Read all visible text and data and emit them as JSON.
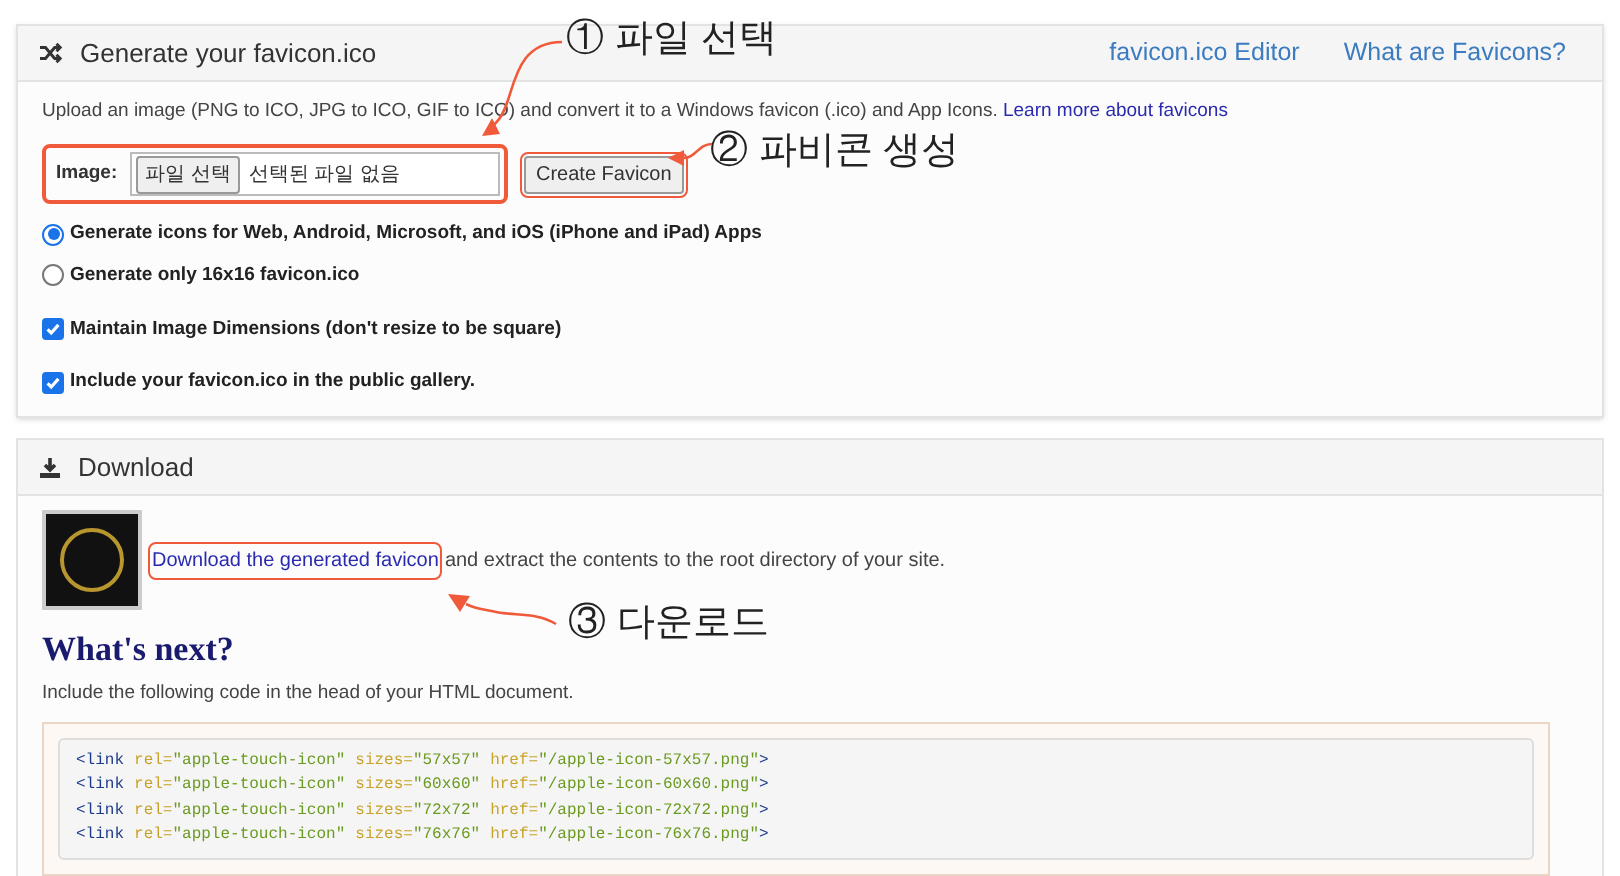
{
  "generator_panel": {
    "title": "Generate your favicon.ico",
    "header_links": [
      "favicon.ico Editor",
      "What are Favicons?"
    ],
    "intro": {
      "text": "Upload an image (PNG to ICO, JPG to ICO, GIF to ICO) and convert it to a Windows favicon (.ico) and App Icons.",
      "link": "Learn more about favicons"
    },
    "image_label": "Image:",
    "file_button": "파일 선택",
    "file_status": "선택된 파일 없음",
    "create_button": "Create Favicon",
    "radios": [
      {
        "label": "Generate icons for Web, Android, Microsoft, and iOS (iPhone and iPad) Apps",
        "selected": true
      },
      {
        "label": "Generate only 16x16 favicon.ico",
        "selected": false
      }
    ],
    "checkboxes": [
      {
        "label": "Maintain Image Dimensions (don't resize to be square)",
        "checked": true
      },
      {
        "label": "Include your favicon.ico in the public gallery.",
        "checked": true
      }
    ]
  },
  "download_panel": {
    "title": "Download",
    "link": "Download the generated favicon",
    "text": "and extract the contents to the root directory of your site.",
    "heading": "What's next?",
    "instruction": "Include the following code in the head of your HTML document.",
    "code_lines": [
      [
        {
          "kind": "tag",
          "text": "<link"
        },
        {
          "kind": "attr",
          "text": "rel="
        },
        {
          "kind": "value",
          "text": "\"apple-touch-icon\""
        },
        {
          "kind": "attr",
          "text": "sizes="
        },
        {
          "kind": "value",
          "text": "\"57x57\""
        },
        {
          "kind": "attr",
          "text": "href="
        },
        {
          "kind": "value",
          "text": "\"/apple-icon-57x57.png\""
        },
        {
          "kind": "tag",
          "text": ">"
        }
      ],
      [
        {
          "kind": "tag",
          "text": "<link"
        },
        {
          "kind": "attr",
          "text": "rel="
        },
        {
          "kind": "value",
          "text": "\"apple-touch-icon\""
        },
        {
          "kind": "attr",
          "text": "sizes="
        },
        {
          "kind": "value",
          "text": "\"60x60\""
        },
        {
          "kind": "attr",
          "text": "href="
        },
        {
          "kind": "value",
          "text": "\"/apple-icon-60x60.png\""
        },
        {
          "kind": "tag",
          "text": ">"
        }
      ],
      [
        {
          "kind": "tag",
          "text": "<link"
        },
        {
          "kind": "attr",
          "text": "rel="
        },
        {
          "kind": "value",
          "text": "\"apple-touch-icon\""
        },
        {
          "kind": "attr",
          "text": "sizes="
        },
        {
          "kind": "value",
          "text": "\"72x72\""
        },
        {
          "kind": "attr",
          "text": "href="
        },
        {
          "kind": "value",
          "text": "\"/apple-icon-72x72.png\""
        },
        {
          "kind": "tag",
          "text": ">"
        }
      ],
      [
        {
          "kind": "tag",
          "text": "<link"
        },
        {
          "kind": "attr",
          "text": "rel="
        },
        {
          "kind": "value",
          "text": "\"apple-touch-icon\""
        },
        {
          "kind": "attr",
          "text": "sizes="
        },
        {
          "kind": "value",
          "text": "\"76x76\""
        },
        {
          "kind": "attr",
          "text": "href="
        },
        {
          "kind": "value",
          "text": "\"/apple-icon-76x76.png\""
        },
        {
          "kind": "tag",
          "text": ">"
        }
      ]
    ]
  },
  "annotations": [
    "① 파일 선택",
    "② 파비콘 생성",
    "③ 다운로드"
  ]
}
